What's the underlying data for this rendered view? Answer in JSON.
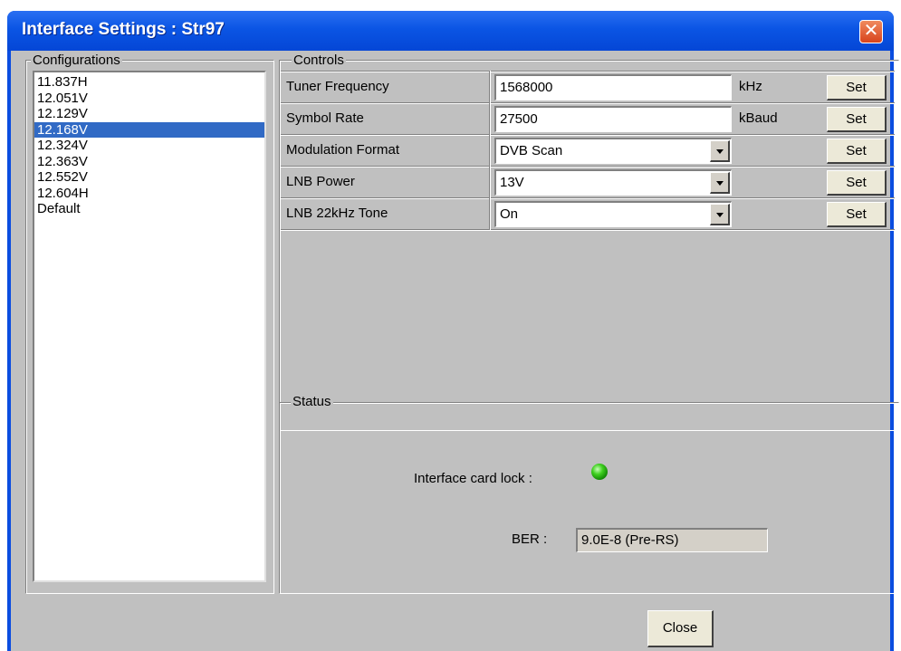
{
  "window": {
    "title": "Interface Settings : Str97",
    "close_glyph": "✕"
  },
  "configurations": {
    "caption": "Configurations",
    "items": [
      "11.837H",
      "12.051V",
      "12.129V",
      "12.168V",
      "12.324V",
      "12.363V",
      "12.552V",
      "12.604H",
      "Default"
    ],
    "selected": "12.168V"
  },
  "controls": {
    "caption": "Controls",
    "tuner_frequency": {
      "label": "Tuner Frequency",
      "value": "1568000",
      "unit": "kHz",
      "button": "Set"
    },
    "symbol_rate": {
      "label": "Symbol Rate",
      "value": "27500",
      "unit": "kBaud",
      "button": "Set"
    },
    "modulation_format": {
      "label": "Modulation Format",
      "value": "DVB Scan",
      "button": "Set"
    },
    "lnb_power": {
      "label": "LNB Power",
      "value": "13V",
      "button": "Set"
    },
    "lnb_tone": {
      "label": "LNB 22kHz Tone",
      "value": "On",
      "button": "Set"
    }
  },
  "status": {
    "caption": "Status",
    "lock_label": "Interface card lock :",
    "lock_state": "locked",
    "lock_color": "#2fc81a",
    "ber_label": "BER :",
    "ber_value": "9.0E-8  (Pre-RS)"
  },
  "footer": {
    "close_button": "Close"
  },
  "colors": {
    "titlebar": "#0b55e4",
    "selection": "#316ac5",
    "dialog_bg": "#c0c0c0"
  }
}
